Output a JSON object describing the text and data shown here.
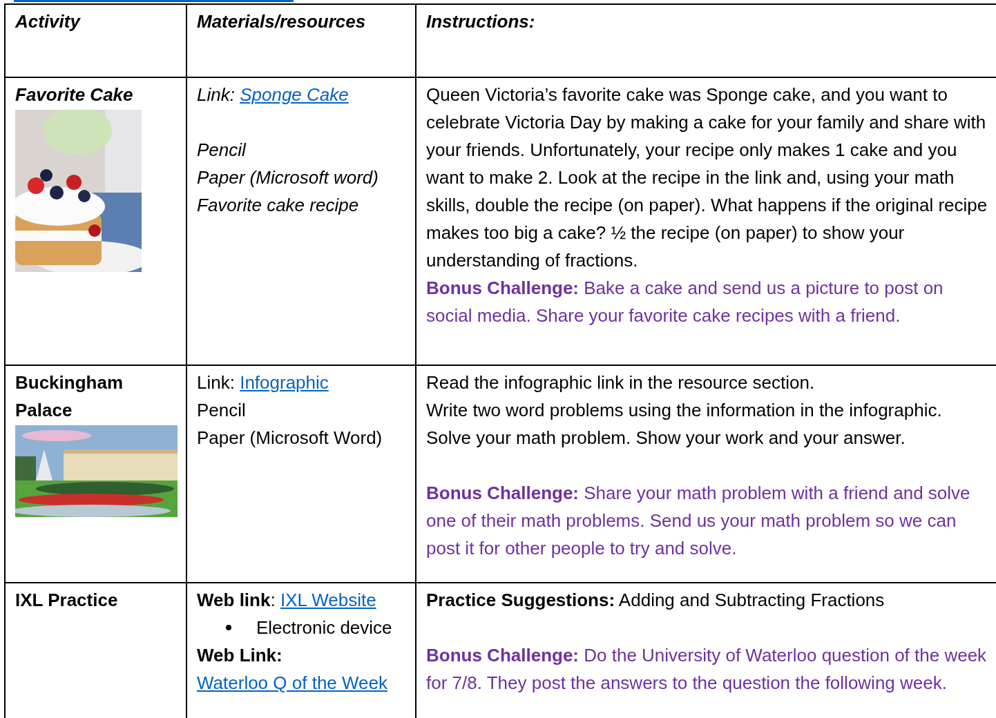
{
  "top_link_underline": true,
  "table": {
    "columns": [
      "Activity",
      "Materials/resources",
      "Instructions:"
    ],
    "rows": [
      {
        "activity": "Favorite Cake",
        "italic": true,
        "image": {
          "kind": "picture"
        },
        "materials": [
          {
            "kind": "link",
            "label": "Link:",
            "link": "Sponge Cake"
          },
          {
            "kind": "spacer"
          },
          {
            "kind": "text",
            "text": "Pencil"
          },
          {
            "kind": "text",
            "text": "Paper (Microsoft word)"
          },
          {
            "kind": "text",
            "text": "Favorite cake recipe"
          }
        ],
        "instructions": [
          {
            "kind": "text",
            "text": "Queen Victoria’s favorite cake was Sponge cake, and you want to celebrate Victoria Day by making a cake for your family and share with your friends. Unfortunately, your recipe only makes 1 cake and you want to make 2. Look at the recipe in the link and, using your math skills, double the recipe (on paper). What happens if the original recipe makes too big a cake? ½ the recipe (on paper) to show your understanding of fractions."
          },
          {
            "kind": "bonus",
            "text": "**Bonus Challenge:** Bake a cake and send us a picture to post on social media. Share your favorite cake recipes with a friend."
          }
        ]
      },
      {
        "activity": "Buckingham Palace",
        "italic": false,
        "image": {
          "kind": "picture"
        },
        "materials": [
          {
            "kind": "link",
            "label": "Link:",
            "link": "Infographic"
          },
          {
            "kind": "text",
            "text": "Pencil"
          },
          {
            "kind": "text",
            "text": "Paper (Microsoft Word)"
          }
        ],
        "instructions": [
          {
            "kind": "text",
            "text": "Read the infographic link in the resource section."
          },
          {
            "kind": "text",
            "text": "Write two word problems using the information in the infographic."
          },
          {
            "kind": "text",
            "text": "Solve your math problem. Show your work and your answer."
          },
          {
            "kind": "spacer"
          },
          {
            "kind": "bonus",
            "text": "**Bonus Challenge:** Share your math problem with a friend and solve one of their math problems. Send us your math problem so we can post it for other people to try and solve."
          }
        ]
      },
      {
        "activity": "IXL Practice",
        "italic": false,
        "materials": [
          {
            "kind": "link",
            "label": "**Web link**:",
            "link": "IXL Website"
          },
          {
            "kind": "bullet",
            "text": "Electronic device"
          },
          {
            "kind": "link",
            "label": "**Web Link:**",
            "link": "Waterloo Q of the Week"
          }
        ],
        "instructions": [
          {
            "kind": "suggestion",
            "text": "**Practice Suggestions:** Adding and Subtracting Fractions"
          },
          {
            "kind": "spacer"
          },
          {
            "kind": "bonus",
            "text": "**Bonus Challenge:** Do the University of Waterloo question of the week for 7/8. They post the answers to the question the following week."
          }
        ]
      }
    ]
  }
}
